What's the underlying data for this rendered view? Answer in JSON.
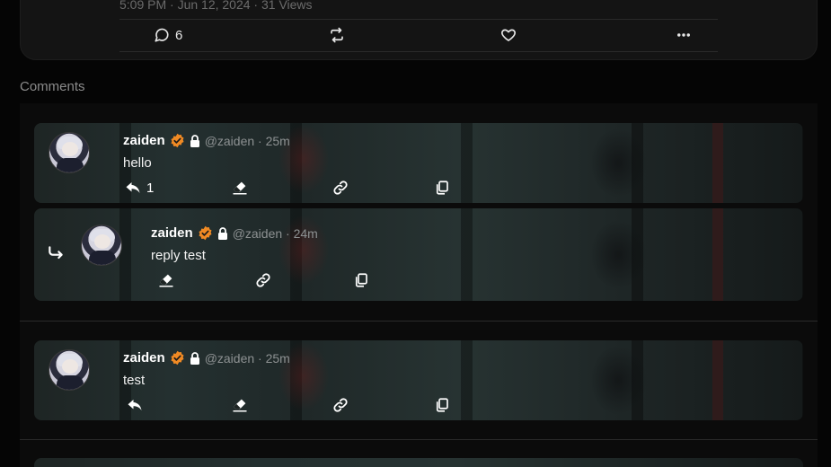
{
  "post": {
    "meta": "5:09 PM · Jun 12, 2024 · 31 Views",
    "comment_count": "6"
  },
  "comments_label": "Comments",
  "comments": [
    {
      "name": "zaiden",
      "handle_time": "@zaiden · 25m",
      "text": "hello",
      "reply_count": "1"
    },
    {
      "name": "zaiden",
      "handle_time": "@zaiden · 24m",
      "text": "reply test"
    },
    {
      "name": "zaiden",
      "handle_time": "@zaiden · 25m",
      "text": "test"
    }
  ],
  "icons": {
    "comment": "comment-icon",
    "retweet": "retweet-icon",
    "like": "heart-icon",
    "more": "more-icon",
    "reply": "reply-icon",
    "erase": "eraser-icon",
    "link": "link-icon",
    "copy": "copy-icon",
    "verified": "verified-badge-icon",
    "lock": "lock-icon"
  },
  "colors": {
    "badge": "#f08a24",
    "background": "#050505"
  }
}
